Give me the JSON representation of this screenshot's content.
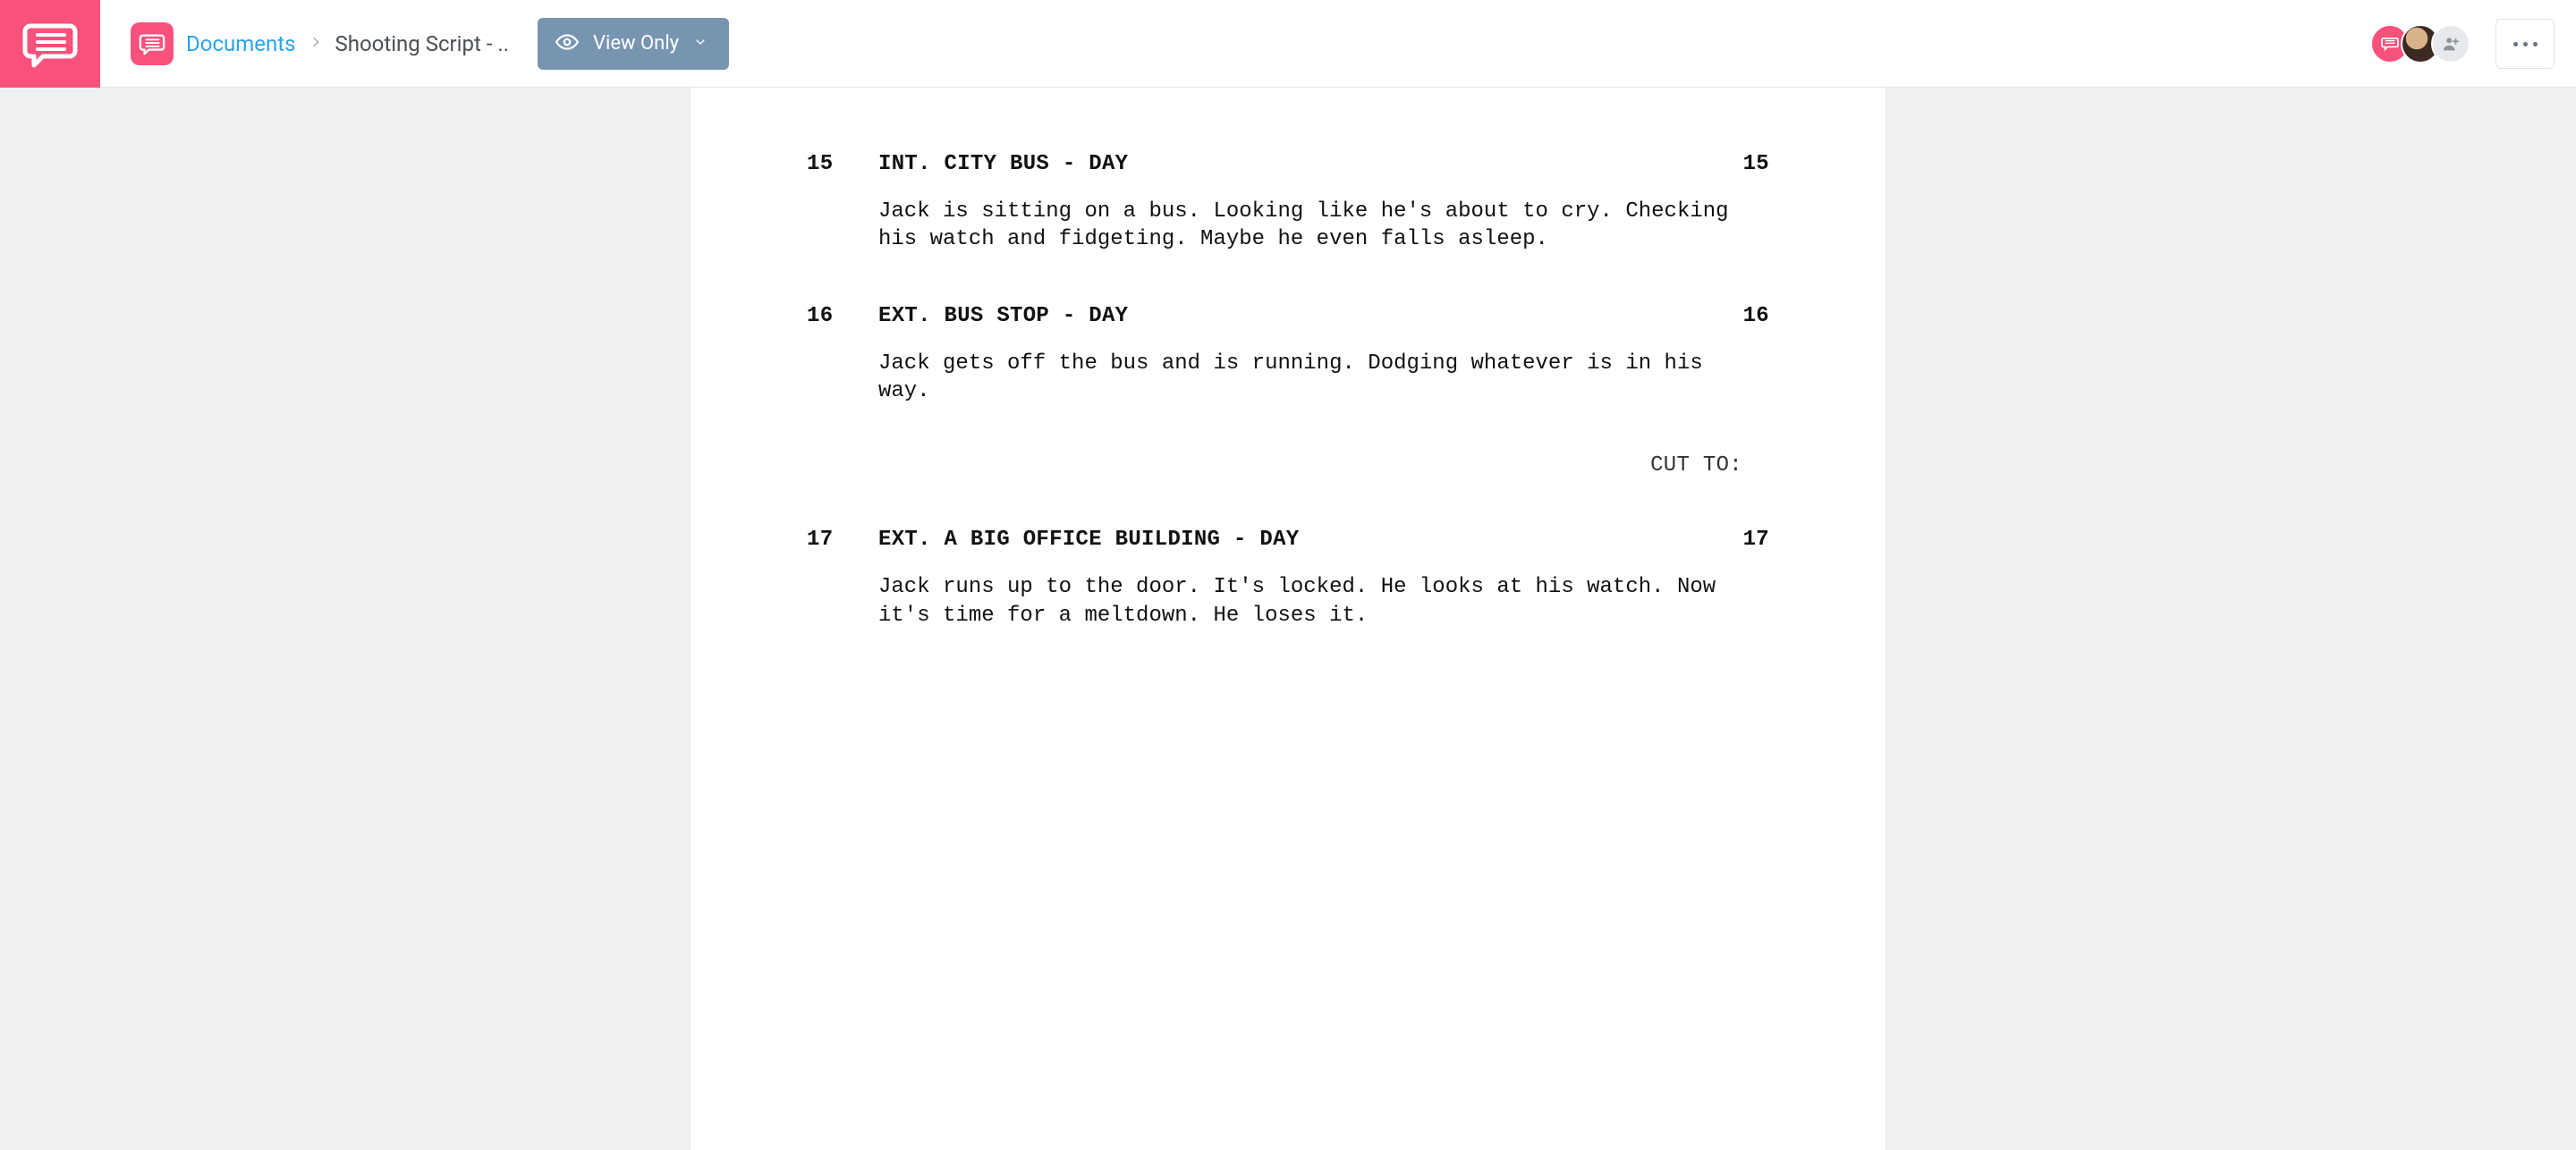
{
  "header": {
    "breadcrumb": {
      "root": "Documents",
      "current": "Shooting Script - .."
    },
    "view_mode": {
      "label": "View Only"
    }
  },
  "script": {
    "scenes": [
      {
        "num": "15",
        "heading": "INT. CITY BUS - DAY",
        "action": "Jack is sitting on a bus. Looking like he's about to cry. Checking his watch and fidgeting. Maybe he even falls asleep."
      },
      {
        "num": "16",
        "heading": "EXT. BUS STOP - DAY",
        "action": "Jack gets off the bus and is running. Dodging whatever is in his way.",
        "transition": "CUT TO:"
      },
      {
        "num": "17",
        "heading": "EXT. A BIG OFFICE BUILDING - DAY",
        "action": "Jack runs up to the door. It's locked. He looks at his watch. Now it's time for a meltdown. He loses it."
      }
    ]
  }
}
